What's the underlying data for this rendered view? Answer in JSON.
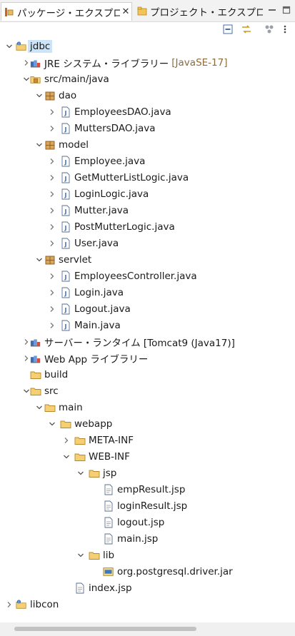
{
  "tabs": [
    {
      "title": "パッケージ・エクスプロ...",
      "close": "✕",
      "icon": "package-explorer-icon"
    },
    {
      "title": "プロジェクト・エクスプロ...",
      "icon": "project-explorer-icon"
    }
  ],
  "tree": [
    {
      "label": "jdbc",
      "icon": "project-icon"
    },
    {
      "label": "JRE システム・ライブラリー",
      "decoration": "[JavaSE-17]",
      "icon": "library-icon"
    },
    {
      "label": "src/main/java",
      "icon": "source-folder-icon"
    },
    {
      "label": "dao",
      "icon": "package-icon"
    },
    {
      "label": "EmployeesDAO.java",
      "icon": "java-file-icon"
    },
    {
      "label": "MuttersDAO.java",
      "icon": "java-file-icon"
    },
    {
      "label": "model",
      "icon": "package-icon"
    },
    {
      "label": "Employee.java",
      "icon": "java-file-icon"
    },
    {
      "label": "GetMutterListLogic.java",
      "icon": "java-file-icon"
    },
    {
      "label": "LoginLogic.java",
      "icon": "java-file-icon"
    },
    {
      "label": "Mutter.java",
      "icon": "java-file-icon"
    },
    {
      "label": "PostMutterLogic.java",
      "icon": "java-file-icon"
    },
    {
      "label": "User.java",
      "icon": "java-file-icon"
    },
    {
      "label": "servlet",
      "icon": "package-icon"
    },
    {
      "label": "EmployeesController.java",
      "icon": "java-file-icon"
    },
    {
      "label": "Login.java",
      "icon": "java-file-icon"
    },
    {
      "label": "Logout.java",
      "icon": "java-file-icon"
    },
    {
      "label": "Main.java",
      "icon": "java-file-icon"
    },
    {
      "label": "サーバー・ランタイム [Tomcat9 (Java17)]",
      "icon": "library-icon"
    },
    {
      "label": "Web App ライブラリー",
      "icon": "library-icon"
    },
    {
      "label": "build",
      "icon": "folder-icon"
    },
    {
      "label": "src",
      "icon": "folder-icon"
    },
    {
      "label": "main",
      "icon": "folder-icon"
    },
    {
      "label": "webapp",
      "icon": "folder-icon"
    },
    {
      "label": "META-INF",
      "icon": "folder-icon"
    },
    {
      "label": "WEB-INF",
      "icon": "folder-icon"
    },
    {
      "label": "jsp",
      "icon": "folder-icon"
    },
    {
      "label": "empResult.jsp",
      "icon": "jsp-file-icon"
    },
    {
      "label": "loginResult.jsp",
      "icon": "jsp-file-icon"
    },
    {
      "label": "logout.jsp",
      "icon": "jsp-file-icon"
    },
    {
      "label": "main.jsp",
      "icon": "jsp-file-icon"
    },
    {
      "label": "lib",
      "icon": "folder-icon"
    },
    {
      "label": "org.postgresql.driver.jar",
      "icon": "jar-icon"
    },
    {
      "label": "index.jsp",
      "icon": "jsp-file-icon"
    },
    {
      "label": "libcon",
      "icon": "project-icon"
    }
  ],
  "colors": {
    "selection": "#cce4f7",
    "decoration": "#8b6b3a",
    "folder": "#e8b960"
  }
}
